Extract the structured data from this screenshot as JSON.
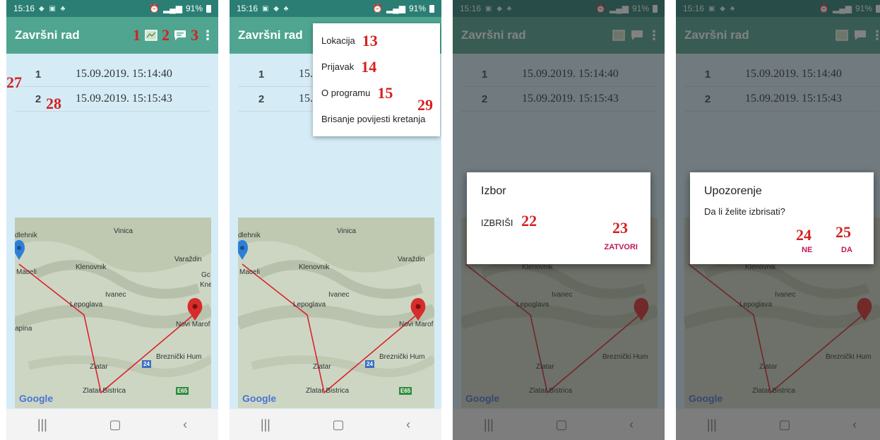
{
  "status": {
    "time": "15:16",
    "battery": "91%"
  },
  "app": {
    "title": "Završni rad"
  },
  "toolbar": {
    "map_icon": "map-icon",
    "message_icon": "message-icon",
    "overflow_icon": "more-vert-icon"
  },
  "annotations": {
    "a1": "1",
    "a2": "2",
    "a3": "3",
    "a13": "13",
    "a14": "14",
    "a15": "15",
    "a22": "22",
    "a23": "23",
    "a24": "24",
    "a25": "25",
    "a27": "27",
    "a28": "28",
    "a29": "29"
  },
  "list": [
    {
      "index": "1",
      "timestamp": "15.09.2019. 15:14:40"
    },
    {
      "index": "2",
      "timestamp": "15.09.2019. 15:15:43"
    }
  ],
  "map": {
    "places": [
      "Vinica",
      "Varaždin",
      "Klenovnik",
      "Maceli",
      "Ivanec",
      "Lepoglava",
      "Novi Marof",
      "Breznički Hum",
      "Zlatar",
      "Zlatar Bistrica",
      "dlehnik",
      "apina",
      "Gc",
      "Kne"
    ],
    "google_label": "Google",
    "road_badges": [
      "24",
      "E65"
    ],
    "route_color": "#d9232d"
  },
  "menu": {
    "items": [
      "Lokacija",
      "Prijavak",
      "O programu",
      "Brisanje povijesti kretanja"
    ]
  },
  "dialog_choice": {
    "title": "Izbor",
    "delete_label": "IZBRIŠI",
    "close_label": "ZATVORI"
  },
  "dialog_warning": {
    "title": "Upozorenje",
    "message": "Da li želite izbrisati?",
    "no_label": "NE",
    "yes_label": "DA"
  },
  "navbar": {
    "recent_icon": "recent-apps-icon",
    "home_icon": "home-icon",
    "back_icon": "back-icon"
  },
  "colors": {
    "statusbar": "#2a7e73",
    "appbar": "#4fa58f",
    "background": "#d5ecf7",
    "accent": "#c0165a",
    "annotation": "#d42020"
  }
}
